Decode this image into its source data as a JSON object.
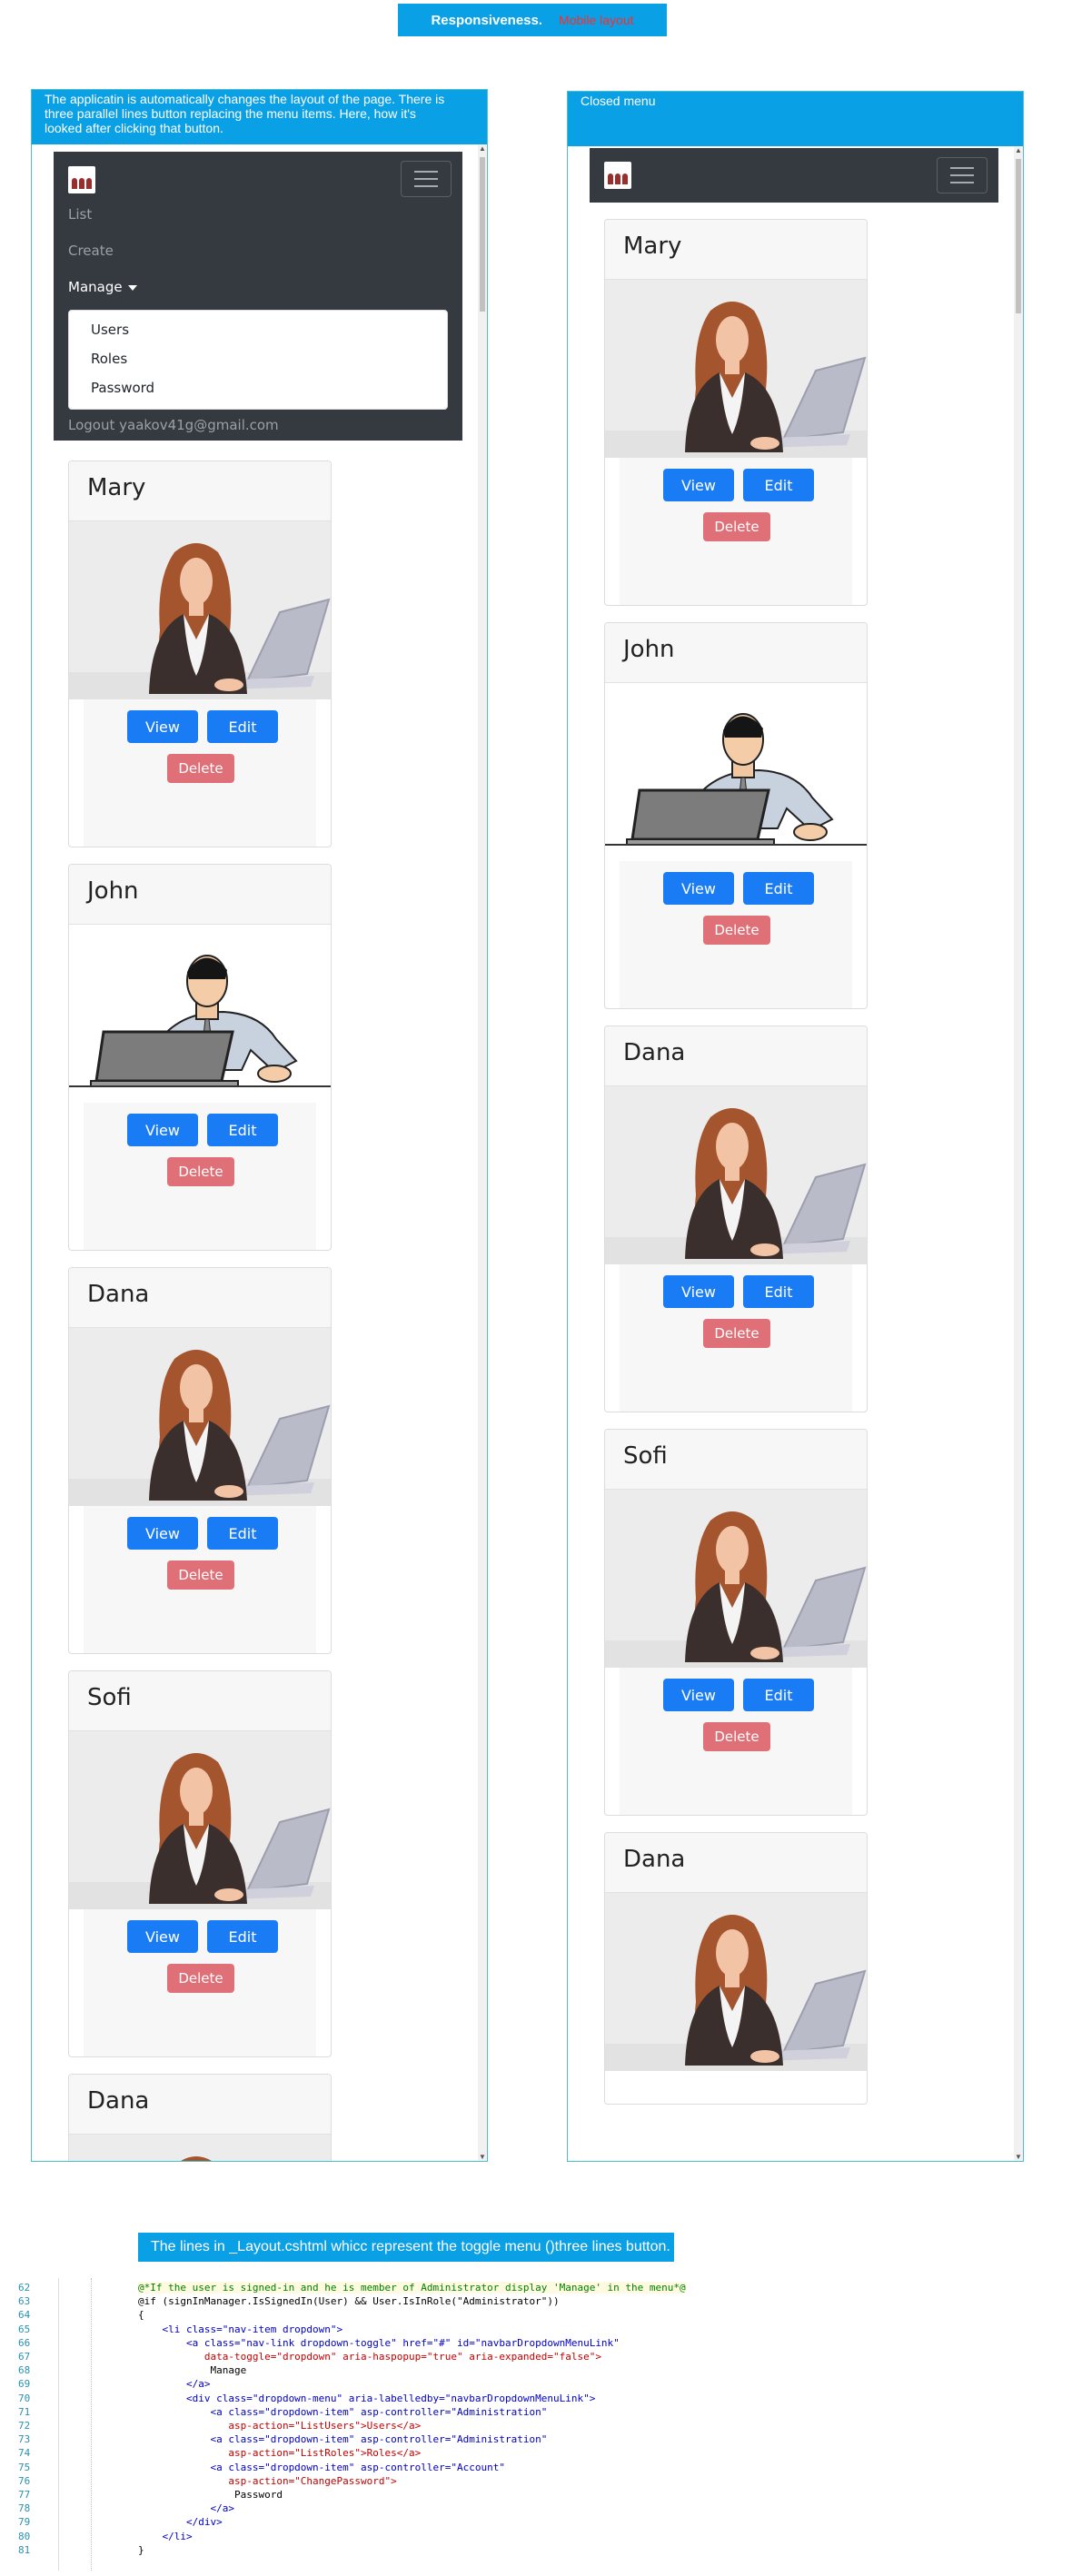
{
  "banner": {
    "title": "Responsiveness.",
    "subtitle": "Mobile layout"
  },
  "left_panel": {
    "caption": "The applicatin is automatically changes the layout of the page. There is three parallel  lines  button replacing the menu items. Here, how it's looked  after clicking that button.",
    "nav": {
      "links": [
        "List",
        "Create"
      ],
      "manage_label": "Manage",
      "dropdown_items": [
        "Users",
        "Roles",
        "Password"
      ],
      "logout_label": "Logout yaakov41g@gmail.com"
    },
    "cards": [
      {
        "name": "Mary",
        "image": "woman-at-laptop-image"
      },
      {
        "name": "John",
        "image": "man-at-laptop-image"
      },
      {
        "name": "Dana",
        "image": "woman-at-laptop-image"
      },
      {
        "name": "Sofi",
        "image": "woman-at-laptop-image"
      },
      {
        "name": "Dana",
        "image": "woman-at-laptop-image"
      }
    ]
  },
  "right_panel": {
    "caption": "Closed menu",
    "cards": [
      {
        "name": "Mary",
        "image": "woman-at-laptop-image"
      },
      {
        "name": "John",
        "image": "man-at-laptop-image"
      },
      {
        "name": "Dana",
        "image": "woman-at-laptop-image"
      },
      {
        "name": "Sofi",
        "image": "woman-at-laptop-image"
      },
      {
        "name": "Dana",
        "image": "woman-at-laptop-image"
      }
    ]
  },
  "buttons": {
    "view": "View",
    "edit": "Edit",
    "delete": "Delete"
  },
  "code_banner": "The lines in _Layout.cshtml whicc represent  the toggle menu ()three lines button.",
  "code": [
    {
      "n": "62",
      "text": "@*If the user is signed-in and he is member of Administrator display 'Manage' in the menu*@"
    },
    {
      "n": "63",
      "text": "@if (signInManager.IsSignedIn(User) && User.IsInRole(\"Administrator\"))"
    },
    {
      "n": "64",
      "text": "{"
    },
    {
      "n": "65",
      "text": "    <li class=\"nav-item dropdown\">"
    },
    {
      "n": "66",
      "text": "        <a class=\"nav-link dropdown-toggle\" href=\"#\" id=\"navbarDropdownMenuLink\""
    },
    {
      "n": "67",
      "text": "           data-toggle=\"dropdown\" aria-haspopup=\"true\" aria-expanded=\"false\">"
    },
    {
      "n": "68",
      "text": "            Manage"
    },
    {
      "n": "69",
      "text": "        </a>"
    },
    {
      "n": "70",
      "text": "        <div class=\"dropdown-menu\" aria-labelledby=\"navbarDropdownMenuLink\">"
    },
    {
      "n": "71",
      "text": "            <a class=\"dropdown-item\" asp-controller=\"Administration\""
    },
    {
      "n": "72",
      "text": "               asp-action=\"ListUsers\">Users</a>"
    },
    {
      "n": "73",
      "text": "            <a class=\"dropdown-item\" asp-controller=\"Administration\""
    },
    {
      "n": "74",
      "text": "               asp-action=\"ListRoles\">Roles</a>"
    },
    {
      "n": "75",
      "text": "            <a class=\"dropdown-item\" asp-controller=\"Account\""
    },
    {
      "n": "76",
      "text": "               asp-action=\"ChangePassword\">"
    },
    {
      "n": "77",
      "text": "                Password"
    },
    {
      "n": "78",
      "text": "            </a>"
    },
    {
      "n": "79",
      "text": "        </div>"
    },
    {
      "n": "80",
      "text": "    </li>"
    },
    {
      "n": "81",
      "text": "}"
    }
  ],
  "colors": {
    "banner": "#0aa0e6",
    "navbar": "#343a40",
    "primary": "#1a7cf5",
    "danger": "#e07078"
  }
}
